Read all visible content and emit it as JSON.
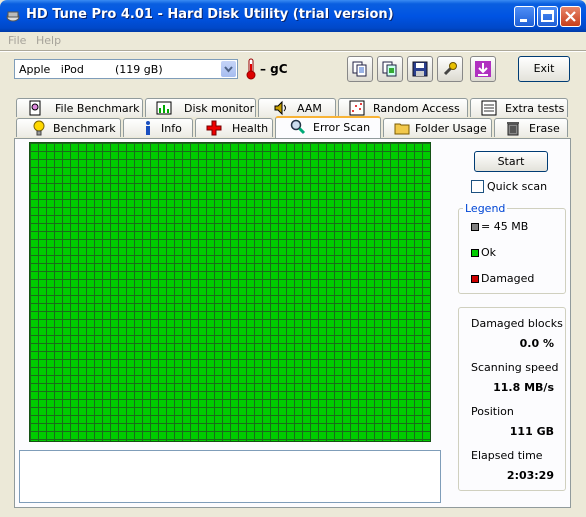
{
  "window": {
    "title": "HD Tune Pro 4.01 - Hard Disk Utility (trial version)"
  },
  "menu": {
    "file": "File",
    "help": "Help"
  },
  "toolbar": {
    "drive_name": "Apple   iPod",
    "drive_size": "(119 gB)",
    "temperature": "– gC",
    "exit_label": "Exit"
  },
  "tabs_top": [
    {
      "label": "File Benchmark",
      "icon": "file-benchmark-icon"
    },
    {
      "label": "Disk monitor",
      "icon": "disk-monitor-icon"
    },
    {
      "label": "AAM",
      "icon": "speaker-icon"
    },
    {
      "label": "Random Access",
      "icon": "random-access-icon"
    },
    {
      "label": "Extra tests",
      "icon": "extra-tests-icon"
    }
  ],
  "tabs_bottom": [
    {
      "label": "Benchmark",
      "icon": "lightbulb-icon"
    },
    {
      "label": "Info",
      "icon": "info-icon"
    },
    {
      "label": "Health",
      "icon": "health-cross-icon"
    },
    {
      "label": "Error Scan",
      "icon": "magnifier-icon",
      "active": true
    },
    {
      "label": "Folder Usage",
      "icon": "folder-icon"
    },
    {
      "label": "Erase",
      "icon": "trash-icon"
    }
  ],
  "scan": {
    "start_label": "Start",
    "quick_scan_label": "Quick scan",
    "quick_scan_checked": false
  },
  "legend": {
    "title": "Legend",
    "block_size": "= 45 MB",
    "ok": "Ok",
    "damaged": "Damaged",
    "colors": {
      "block": "#808080",
      "ok": "#00cc00",
      "damaged": "#cc0000"
    }
  },
  "stats": {
    "damaged_blocks_label": "Damaged blocks",
    "damaged_blocks_value": "0.0 %",
    "scanning_speed_label": "Scanning speed",
    "scanning_speed_value": "11.8 MB/s",
    "position_label": "Position",
    "position_value": "111 GB",
    "elapsed_label": "Elapsed time",
    "elapsed_value": "2:03:29"
  }
}
